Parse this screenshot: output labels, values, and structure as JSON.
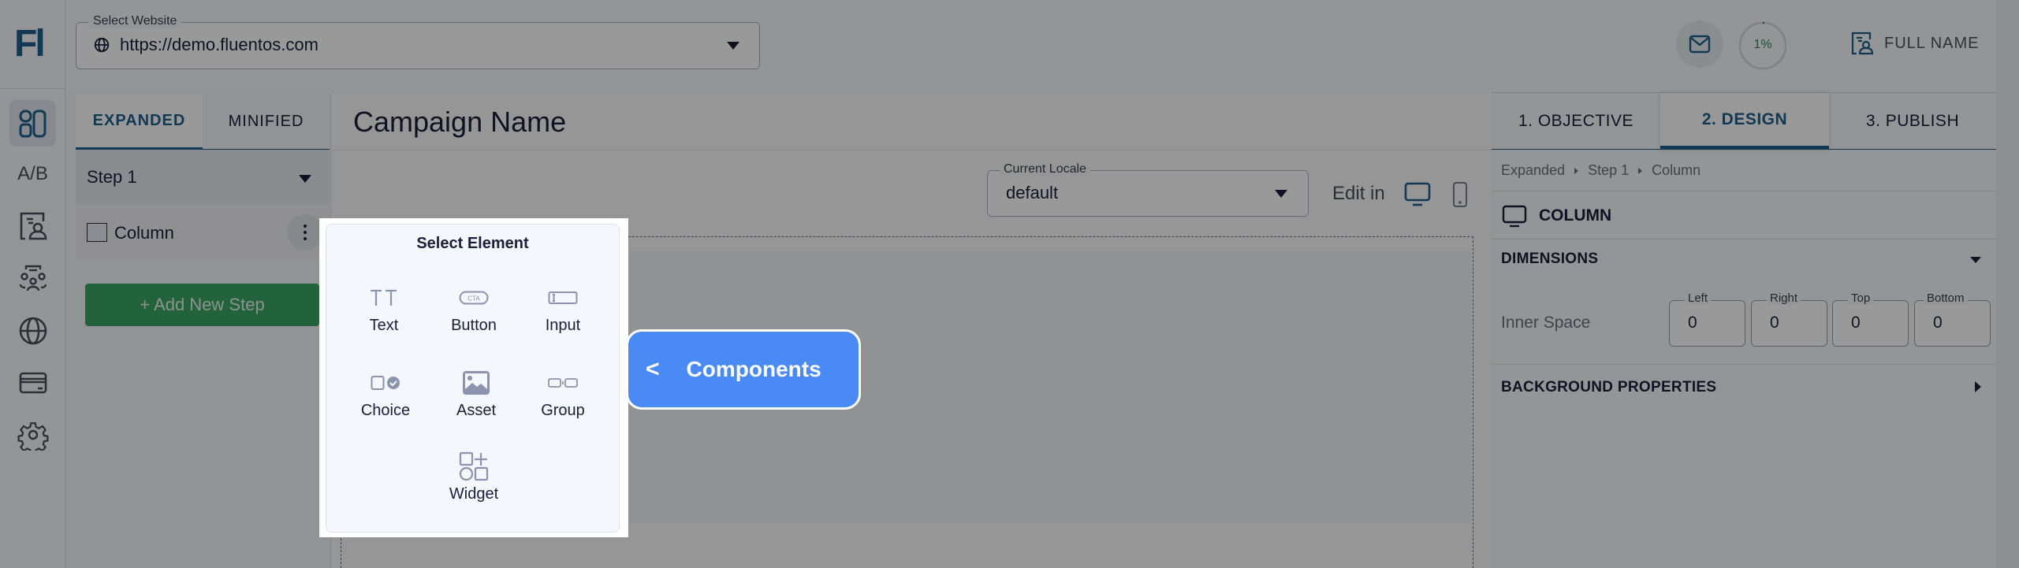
{
  "app": {
    "logo_text": "Fl",
    "rail_items": [
      {
        "name": "campaigns",
        "icon": "layout-grid-icon",
        "active": true
      },
      {
        "name": "ab-testing",
        "icon": "ab-text-icon",
        "label": "A/B"
      },
      {
        "name": "user-profiles",
        "icon": "user-card-icon"
      },
      {
        "name": "segments",
        "icon": "audience-group-icon"
      },
      {
        "name": "websites",
        "icon": "globe-icon"
      },
      {
        "name": "billing",
        "icon": "credit-card-icon"
      },
      {
        "name": "settings",
        "icon": "gear-icon"
      }
    ]
  },
  "header": {
    "website_select": {
      "legend": "Select Website",
      "value": "https://demo.fluentos.com"
    },
    "progress": {
      "value_percent": 1,
      "label": "1%"
    },
    "user": {
      "name": "FULL NAME"
    },
    "colors": {
      "brand": "#1f5f8b",
      "progress": "#2d8a4e"
    }
  },
  "steps_panel": {
    "tabs": [
      {
        "label": "EXPANDED",
        "active": true
      },
      {
        "label": "MINIFIED",
        "active": false
      }
    ],
    "step_select": {
      "value": "Step 1"
    },
    "elements": [
      {
        "label": "Column"
      }
    ],
    "add_step_label": "+ Add New Step",
    "add_step_color": "#3aa564"
  },
  "canvas": {
    "title": "Campaign Name",
    "locale": {
      "legend": "Current Locale",
      "value": "default"
    },
    "edit_in_label": "Edit in",
    "devices": [
      "desktop",
      "mobile"
    ]
  },
  "element_picker": {
    "title": "Select Element",
    "items": [
      {
        "label": "Text",
        "icon": "text-icon"
      },
      {
        "label": "Button",
        "icon": "cta-button-icon",
        "icon_text": "CTA"
      },
      {
        "label": "Input",
        "icon": "input-field-icon"
      },
      {
        "label": "Choice",
        "icon": "choice-icon"
      },
      {
        "label": "Asset",
        "icon": "image-icon"
      },
      {
        "label": "Group",
        "icon": "group-icon"
      },
      {
        "label": "Widget",
        "icon": "widget-icon"
      }
    ]
  },
  "tour_tooltip": {
    "chevron": "<",
    "label": "Components",
    "color": "#4a8af5"
  },
  "inspector": {
    "steps": [
      {
        "label": "1. OBJECTIVE",
        "active": false
      },
      {
        "label": "2. DESIGN",
        "active": true
      },
      {
        "label": "3. PUBLISH",
        "active": false
      }
    ],
    "breadcrumb": [
      "Expanded",
      "Step 1",
      "Column"
    ],
    "element_title": "COLUMN",
    "sections": {
      "dimensions": "DIMENSIONS",
      "background": "BACKGROUND PROPERTIES"
    },
    "inner_space": {
      "label": "Inner Space",
      "fields": [
        {
          "legend": "Left",
          "value": "0"
        },
        {
          "legend": "Right",
          "value": "0"
        },
        {
          "legend": "Top",
          "value": "0"
        },
        {
          "legend": "Bottom",
          "value": "0"
        }
      ]
    }
  }
}
